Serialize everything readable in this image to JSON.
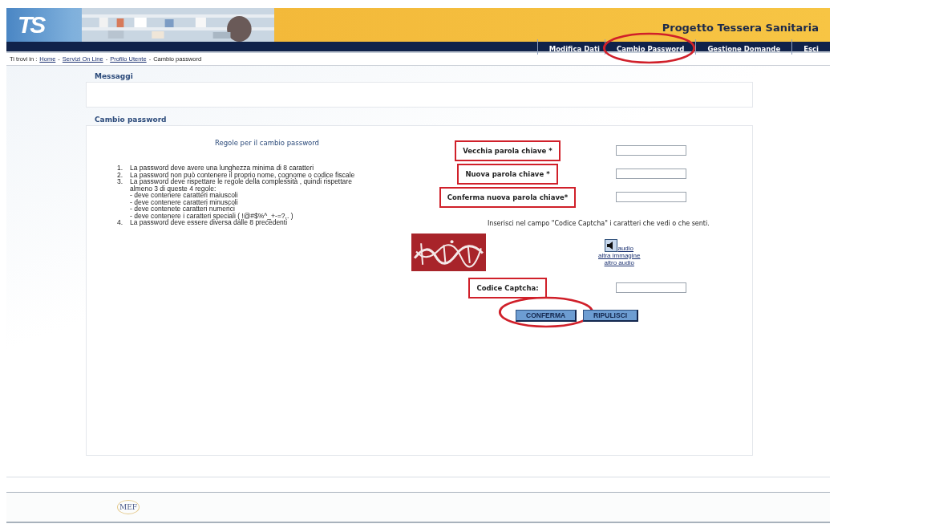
{
  "header": {
    "logo": "TS",
    "title": "Progetto Tessera Sanitaria",
    "nav": [
      {
        "label": "Modifica Dati",
        "circled": false
      },
      {
        "label": "Cambio Password",
        "circled": true
      },
      {
        "label": "Gestione Domande",
        "circled": false
      },
      {
        "label": "Esci",
        "circled": false
      }
    ]
  },
  "breadcrumb": {
    "prefix": "Ti trovi in :",
    "separator": "-",
    "links": [
      "Home",
      "Servizi On Line",
      "Profilo Utente"
    ],
    "current": "Cambio password"
  },
  "messages": {
    "title": "Messaggi"
  },
  "form": {
    "title": "Cambio password",
    "rules_title": "Regole per il cambio password",
    "rules": [
      {
        "number": "1.",
        "text": "La password deve avere una lunghezza minima di 8 caratteri"
      },
      {
        "number": "2.",
        "text": "La password non può contenere il proprio nome, cognome o codice fiscale"
      },
      {
        "number": "3.",
        "text": "La password deve rispettare le regole della complessità , quindi rispettare almeno 3 di queste 4 regole:",
        "sub": [
          "- deve contenere caratteri maiuscoli",
          "- deve contenere caratteri minuscoli",
          "- deve contenete caratteri numerici",
          "- deve contenere i caratteri speciali ( !@#$%^_+-=?,. )"
        ]
      },
      {
        "number": "4.",
        "text": "La password deve essere diversa dalle 8 precedenti"
      }
    ],
    "fields": [
      {
        "label": "Vecchia parola chiave *",
        "boxed": true
      },
      {
        "label": "Nuova parola chiave *",
        "boxed": true
      },
      {
        "label": "Conferma nuova parola chiave*",
        "boxed": true
      }
    ],
    "captcha_hint": "Inserisci nel campo \"Codice Captcha\" i caratteri che vedi o che senti.",
    "captcha_links": [
      "audio",
      "altra immagine",
      "altro audio"
    ],
    "captcha_field": {
      "label": "Codice Captcha:",
      "boxed": true
    },
    "buttons": [
      {
        "label": "CONFERMA",
        "circled": true
      },
      {
        "label": "RIPULISCI",
        "circled": false
      }
    ]
  },
  "footer": {
    "logo": "MEF"
  }
}
